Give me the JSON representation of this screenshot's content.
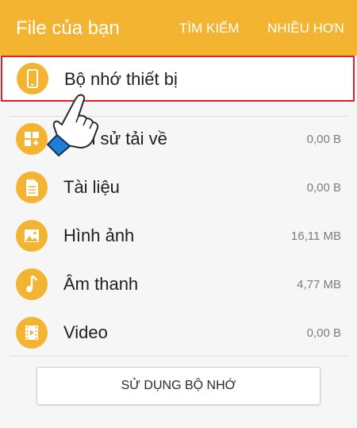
{
  "header": {
    "title": "File của bạn",
    "search_label": "TÌM KIẾM",
    "more_label": "NHIỀU HƠN"
  },
  "items": [
    {
      "label": "Bộ nhớ thiết bị",
      "size": "",
      "icon": "phone-icon"
    },
    {
      "label": "Lịch sử tải về",
      "size": "0,00 B",
      "icon": "download-history-icon"
    },
    {
      "label": "Tài liệu",
      "size": "0,00 B",
      "icon": "document-icon"
    },
    {
      "label": "Hình ảnh",
      "size": "16,11 MB",
      "icon": "image-icon"
    },
    {
      "label": "Âm thanh",
      "size": "4,77 MB",
      "icon": "music-note-icon"
    },
    {
      "label": "Video",
      "size": "0,00 B",
      "icon": "video-film-icon"
    }
  ],
  "storage_button_label": "SỬ DỤNG BỘ NHỚ",
  "colors": {
    "accent": "#f2b431",
    "highlight_border": "#e4202a"
  }
}
